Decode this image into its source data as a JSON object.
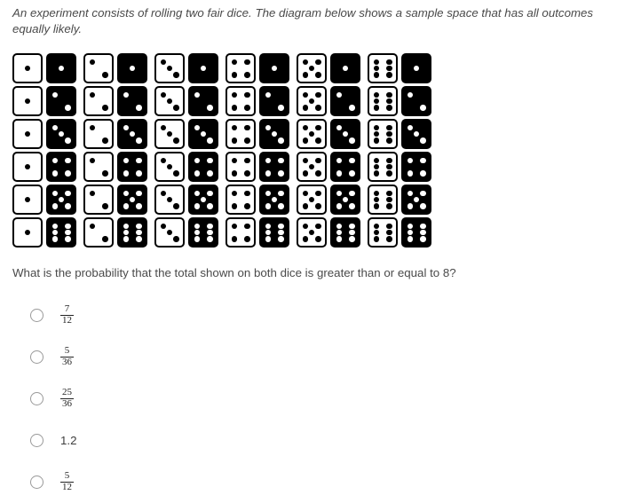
{
  "prompt": "An experiment consists of rolling two fair dice. The diagram below shows a sample space that has all outcomes equally likely.",
  "question": "What is the probability that the total shown on both dice is greater than or equal to 8?",
  "sample_space": {
    "description": "6 by 6 grid of dice pairs; each cell shows one white die and one black die",
    "columns": 6,
    "rows": 6,
    "white_die_values_by_column": [
      1,
      2,
      3,
      4,
      5,
      6
    ],
    "black_die_values_by_row": [
      1,
      2,
      3,
      4,
      5,
      6
    ],
    "pairs": [
      [
        [
          1,
          1
        ],
        [
          2,
          1
        ],
        [
          3,
          1
        ],
        [
          4,
          1
        ],
        [
          5,
          1
        ],
        [
          6,
          1
        ]
      ],
      [
        [
          1,
          2
        ],
        [
          2,
          2
        ],
        [
          3,
          2
        ],
        [
          4,
          2
        ],
        [
          5,
          2
        ],
        [
          6,
          2
        ]
      ],
      [
        [
          1,
          3
        ],
        [
          2,
          3
        ],
        [
          3,
          3
        ],
        [
          4,
          3
        ],
        [
          5,
          3
        ],
        [
          6,
          3
        ]
      ],
      [
        [
          1,
          4
        ],
        [
          2,
          4
        ],
        [
          3,
          4
        ],
        [
          4,
          4
        ],
        [
          5,
          4
        ],
        [
          6,
          4
        ]
      ],
      [
        [
          1,
          5
        ],
        [
          2,
          5
        ],
        [
          3,
          5
        ],
        [
          4,
          5
        ],
        [
          5,
          5
        ],
        [
          6,
          5
        ]
      ],
      [
        [
          1,
          6
        ],
        [
          2,
          6
        ],
        [
          3,
          6
        ],
        [
          4,
          6
        ],
        [
          5,
          6
        ],
        [
          6,
          6
        ]
      ]
    ],
    "colors": {
      "white_die_face": "#ffffff",
      "white_die_pip": "#000000",
      "black_die_face": "#000000",
      "black_die_pip": "#ffffff"
    }
  },
  "options": [
    {
      "id": "a",
      "type": "fraction",
      "numerator": "7",
      "denominator": "12",
      "selected": false
    },
    {
      "id": "b",
      "type": "fraction",
      "numerator": "5",
      "denominator": "36",
      "selected": false
    },
    {
      "id": "c",
      "type": "fraction",
      "numerator": "25",
      "denominator": "36",
      "selected": false
    },
    {
      "id": "d",
      "type": "plain",
      "text": "1.2",
      "selected": false
    },
    {
      "id": "e",
      "type": "fraction",
      "numerator": "5",
      "denominator": "12",
      "selected": false
    }
  ]
}
